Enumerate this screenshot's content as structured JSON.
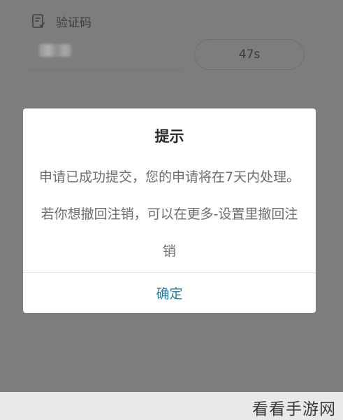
{
  "form": {
    "code_label": "验证码",
    "countdown": "47s"
  },
  "dialog": {
    "title": "提示",
    "message": "申请已成功提交，您的申请将在7天内处理。若你想撤回注销，可以在更多-设置里撤回注销",
    "confirm_label": "确定"
  },
  "watermark": {
    "text": "看看手游网"
  },
  "colors": {
    "overlay": "#7d7d7d",
    "dialog_bg": "#ffffff",
    "confirm_text": "#2e7d9e",
    "message_text": "#6d6d6d"
  },
  "icons": {
    "code": "document-check-icon"
  }
}
